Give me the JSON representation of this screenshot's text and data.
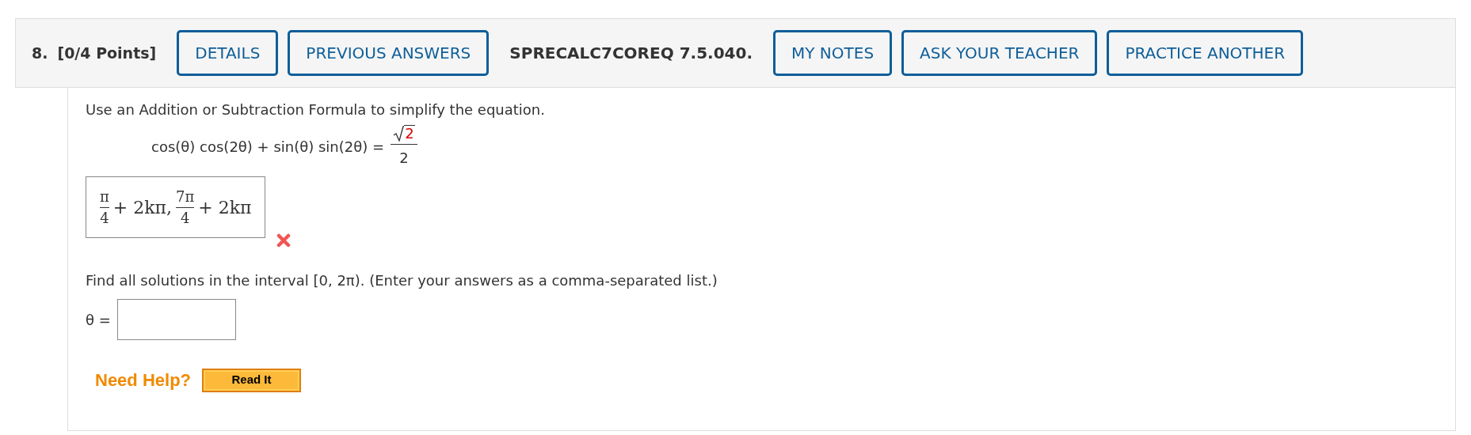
{
  "header": {
    "number": "8.",
    "points": "[0/4 Points]",
    "items": [
      {
        "kind": "button",
        "label": "DETAILS"
      },
      {
        "kind": "button",
        "label": "PREVIOUS ANSWERS"
      },
      {
        "kind": "text",
        "label": "SPRECALC7COREQ 7.5.040."
      },
      {
        "kind": "button",
        "label": "MY NOTES"
      },
      {
        "kind": "button",
        "label": "ASK YOUR TEACHER"
      },
      {
        "kind": "button",
        "label": "PRACTICE ANOTHER"
      }
    ]
  },
  "part1": {
    "prompt": "Use an Addition or Subtraction Formula to simplify the equation.",
    "equation": {
      "lhs": "cos(θ) cos(2θ) + sin(θ) sin(2θ) =",
      "radicand": "2",
      "radicand_highlighted": true,
      "denominator": "2"
    },
    "answer": {
      "terms": [
        {
          "kind": "fraction",
          "numerator": "π",
          "denominator": "4"
        },
        {
          "kind": "text",
          "text": "+ 2kπ,"
        },
        {
          "kind": "fraction",
          "numerator": "7π",
          "denominator": "4"
        },
        {
          "kind": "text",
          "text": "+ 2kπ"
        }
      ],
      "correct": false
    }
  },
  "part2": {
    "prompt": "Find all solutions in the interval [0, 2π). (Enter your answers as a comma-separated list.)",
    "label": "θ ="
  },
  "help": {
    "label": "Need Help?",
    "buttons": [
      "Read It"
    ]
  }
}
